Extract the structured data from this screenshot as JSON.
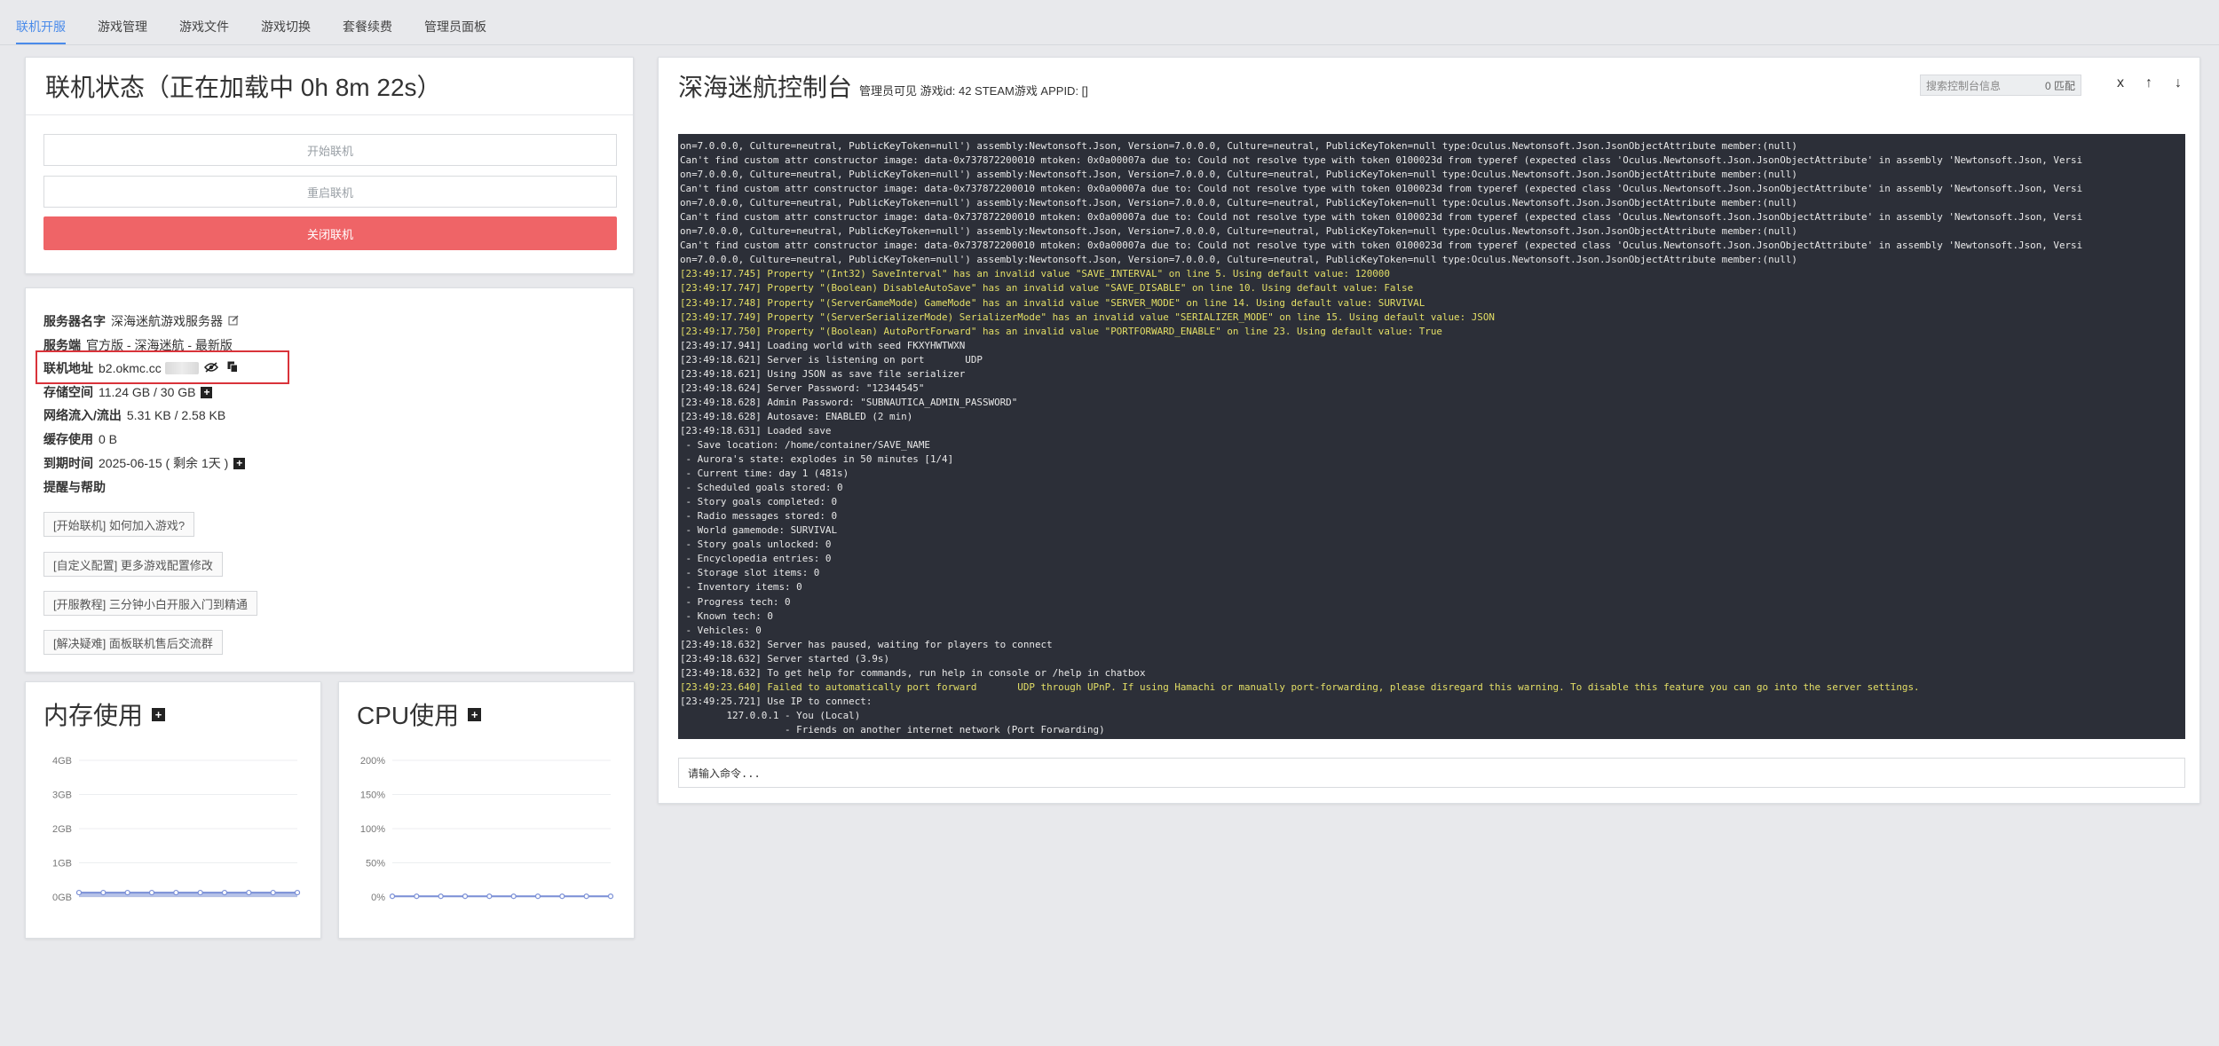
{
  "tabs": [
    {
      "label": "联机开服",
      "active": true
    },
    {
      "label": "游戏管理"
    },
    {
      "label": "游戏文件"
    },
    {
      "label": "游戏切换"
    },
    {
      "label": "套餐续费"
    },
    {
      "label": "管理员面板"
    }
  ],
  "status": {
    "title": "联机状态（正在加载中 0h 8m 22s）",
    "start_label": "开始联机",
    "restart_label": "重启联机",
    "stop_label": "关闭联机"
  },
  "info": {
    "server_name_label": "服务器名字",
    "server_name": "深海迷航游戏服务器",
    "server_side_label": "服务端",
    "server_side": "官方版 - 深海迷航 - 最新版",
    "address_label": "联机地址",
    "address": "b2.okmc.cc",
    "storage_label": "存储空间",
    "storage": "11.24 GB / 30 GB",
    "network_label": "网络流入/流出",
    "network": "5.31 KB / 2.58 KB",
    "cache_label": "缓存使用",
    "cache": "0 B",
    "expire_label": "到期时间",
    "expire": "2025-06-15 ( 剩余 1天 )",
    "help_title": "提醒与帮助",
    "help_buttons": [
      "[开始联机] 如何加入游戏?",
      "[自定义配置] 更多游戏配置修改",
      "[开服教程] 三分钟小白开服入门到精通",
      "[解决疑难] 面板联机售后交流群"
    ]
  },
  "memory": {
    "title": "内存使用",
    "y_ticks": [
      "4GB",
      "3GB",
      "2GB",
      "1GB",
      "0GB"
    ]
  },
  "cpu": {
    "title": "CPU使用",
    "y_ticks": [
      "200%",
      "150%",
      "100%",
      "50%",
      "0%"
    ]
  },
  "chart_data": [
    {
      "type": "area",
      "title": "内存使用",
      "ylim": [
        0,
        4
      ],
      "y_unit": "GB",
      "values": [
        0.05,
        0.05,
        0.05,
        0.05,
        0.05,
        0.05,
        0.05,
        0.05,
        0.05,
        0.05
      ],
      "color": "#7a8fd6"
    },
    {
      "type": "line",
      "title": "CPU使用",
      "ylim": [
        0,
        200
      ],
      "y_unit": "%",
      "values": [
        1,
        1,
        1,
        1,
        1,
        1,
        1,
        1,
        1,
        1
      ],
      "color": "#7a8fd6"
    }
  ],
  "console": {
    "title": "深海迷航控制台",
    "subtitle": "管理员可见 游戏id: 42 STEAM游戏 APPID: []",
    "search_placeholder": "搜索控制台信息",
    "match_count": "0 匹配",
    "clear_label": "x",
    "up_label": "↑",
    "down_label": "↓",
    "input_placeholder": "请输入命令...",
    "lines": [
      {
        "t": "on=7.0.0.0, Culture=neutral, PublicKeyToken=null') assembly:Newtonsoft.Json, Version=7.0.0.0, Culture=neutral, PublicKeyToken=null type:Oculus.Newtonsoft.Json.JsonObjectAttribute member:(null)"
      },
      {
        "t": "Can't find custom attr constructor image: data-0x737872200010 mtoken: 0x0a00007a due to: Could not resolve type with token 0100023d from typeref (expected class 'Oculus.Newtonsoft.Json.JsonObjectAttribute' in assembly 'Newtonsoft.Json, Versi"
      },
      {
        "t": "on=7.0.0.0, Culture=neutral, PublicKeyToken=null') assembly:Newtonsoft.Json, Version=7.0.0.0, Culture=neutral, PublicKeyToken=null type:Oculus.Newtonsoft.Json.JsonObjectAttribute member:(null)"
      },
      {
        "t": "Can't find custom attr constructor image: data-0x737872200010 mtoken: 0x0a00007a due to: Could not resolve type with token 0100023d from typeref (expected class 'Oculus.Newtonsoft.Json.JsonObjectAttribute' in assembly 'Newtonsoft.Json, Versi"
      },
      {
        "t": "on=7.0.0.0, Culture=neutral, PublicKeyToken=null') assembly:Newtonsoft.Json, Version=7.0.0.0, Culture=neutral, PublicKeyToken=null type:Oculus.Newtonsoft.Json.JsonObjectAttribute member:(null)"
      },
      {
        "t": "Can't find custom attr constructor image: data-0x737872200010 mtoken: 0x0a00007a due to: Could not resolve type with token 0100023d from typeref (expected class 'Oculus.Newtonsoft.Json.JsonObjectAttribute' in assembly 'Newtonsoft.Json, Versi"
      },
      {
        "t": "on=7.0.0.0, Culture=neutral, PublicKeyToken=null') assembly:Newtonsoft.Json, Version=7.0.0.0, Culture=neutral, PublicKeyToken=null type:Oculus.Newtonsoft.Json.JsonObjectAttribute member:(null)"
      },
      {
        "t": "Can't find custom attr constructor image: data-0x737872200010 mtoken: 0x0a00007a due to: Could not resolve type with token 0100023d from typeref (expected class 'Oculus.Newtonsoft.Json.JsonObjectAttribute' in assembly 'Newtonsoft.Json, Versi"
      },
      {
        "t": "on=7.0.0.0, Culture=neutral, PublicKeyToken=null') assembly:Newtonsoft.Json, Version=7.0.0.0, Culture=neutral, PublicKeyToken=null type:Oculus.Newtonsoft.Json.JsonObjectAttribute member:(null)"
      },
      {
        "t": "[23:49:17.745] Property \"(Int32) SaveInterval\" has an invalid value \"SAVE_INTERVAL\" on line 5. Using default value: 120000",
        "warn": true
      },
      {
        "t": "[23:49:17.747] Property \"(Boolean) DisableAutoSave\" has an invalid value \"SAVE_DISABLE\" on line 10. Using default value: False",
        "warn": true
      },
      {
        "t": "[23:49:17.748] Property \"(ServerGameMode) GameMode\" has an invalid value \"SERVER_MODE\" on line 14. Using default value: SURVIVAL",
        "warn": true
      },
      {
        "t": "[23:49:17.749] Property \"(ServerSerializerMode) SerializerMode\" has an invalid value \"SERIALIZER_MODE\" on line 15. Using default value: JSON",
        "warn": true
      },
      {
        "t": "[23:49:17.750] Property \"(Boolean) AutoPortForward\" has an invalid value \"PORTFORWARD_ENABLE\" on line 23. Using default value: True",
        "warn": true
      },
      {
        "t": "[23:49:17.941] Loading world with seed FKXYHWTWXN"
      },
      {
        "t": "[23:49:18.621] Server is listening on port       UDP"
      },
      {
        "t": "[23:49:18.621] Using JSON as save file serializer"
      },
      {
        "t": "[23:49:18.624] Server Password: \"12344545\""
      },
      {
        "t": "[23:49:18.628] Admin Password: \"SUBNAUTICA_ADMIN_PASSWORD\""
      },
      {
        "t": "[23:49:18.628] Autosave: ENABLED (2 min)"
      },
      {
        "t": "[23:49:18.631] Loaded save"
      },
      {
        "t": " - Save location: /home/container/SAVE_NAME"
      },
      {
        "t": " - Aurora's state: explodes in 50 minutes [1/4]"
      },
      {
        "t": " - Current time: day 1 (481s)"
      },
      {
        "t": " - Scheduled goals stored: 0"
      },
      {
        "t": " - Story goals completed: 0"
      },
      {
        "t": " - Radio messages stored: 0"
      },
      {
        "t": " - World gamemode: SURVIVAL"
      },
      {
        "t": " - Story goals unlocked: 0"
      },
      {
        "t": " - Encyclopedia entries: 0"
      },
      {
        "t": " - Storage slot items: 0"
      },
      {
        "t": " - Inventory items: 0"
      },
      {
        "t": " - Progress tech: 0"
      },
      {
        "t": " - Known tech: 0"
      },
      {
        "t": " - Vehicles: 0"
      },
      {
        "t": "[23:49:18.632] Server has paused, waiting for players to connect"
      },
      {
        "t": "[23:49:18.632] Server started (3.9s)"
      },
      {
        "t": "[23:49:18.632] To get help for commands, run help in console or /help in chatbox"
      },
      {
        "t": "[23:49:23.640] Failed to automatically port forward       UDP through UPnP. If using Hamachi or manually port-forwarding, please disregard this warning. To disable this feature you can go into the server settings.",
        "warn": true
      },
      {
        "t": "[23:49:25.721] Use IP to connect:"
      },
      {
        "t": "        127.0.0.1 - You (Local)"
      },
      {
        "t": "                  - Friends on another internet network (Port Forwarding)"
      }
    ]
  }
}
